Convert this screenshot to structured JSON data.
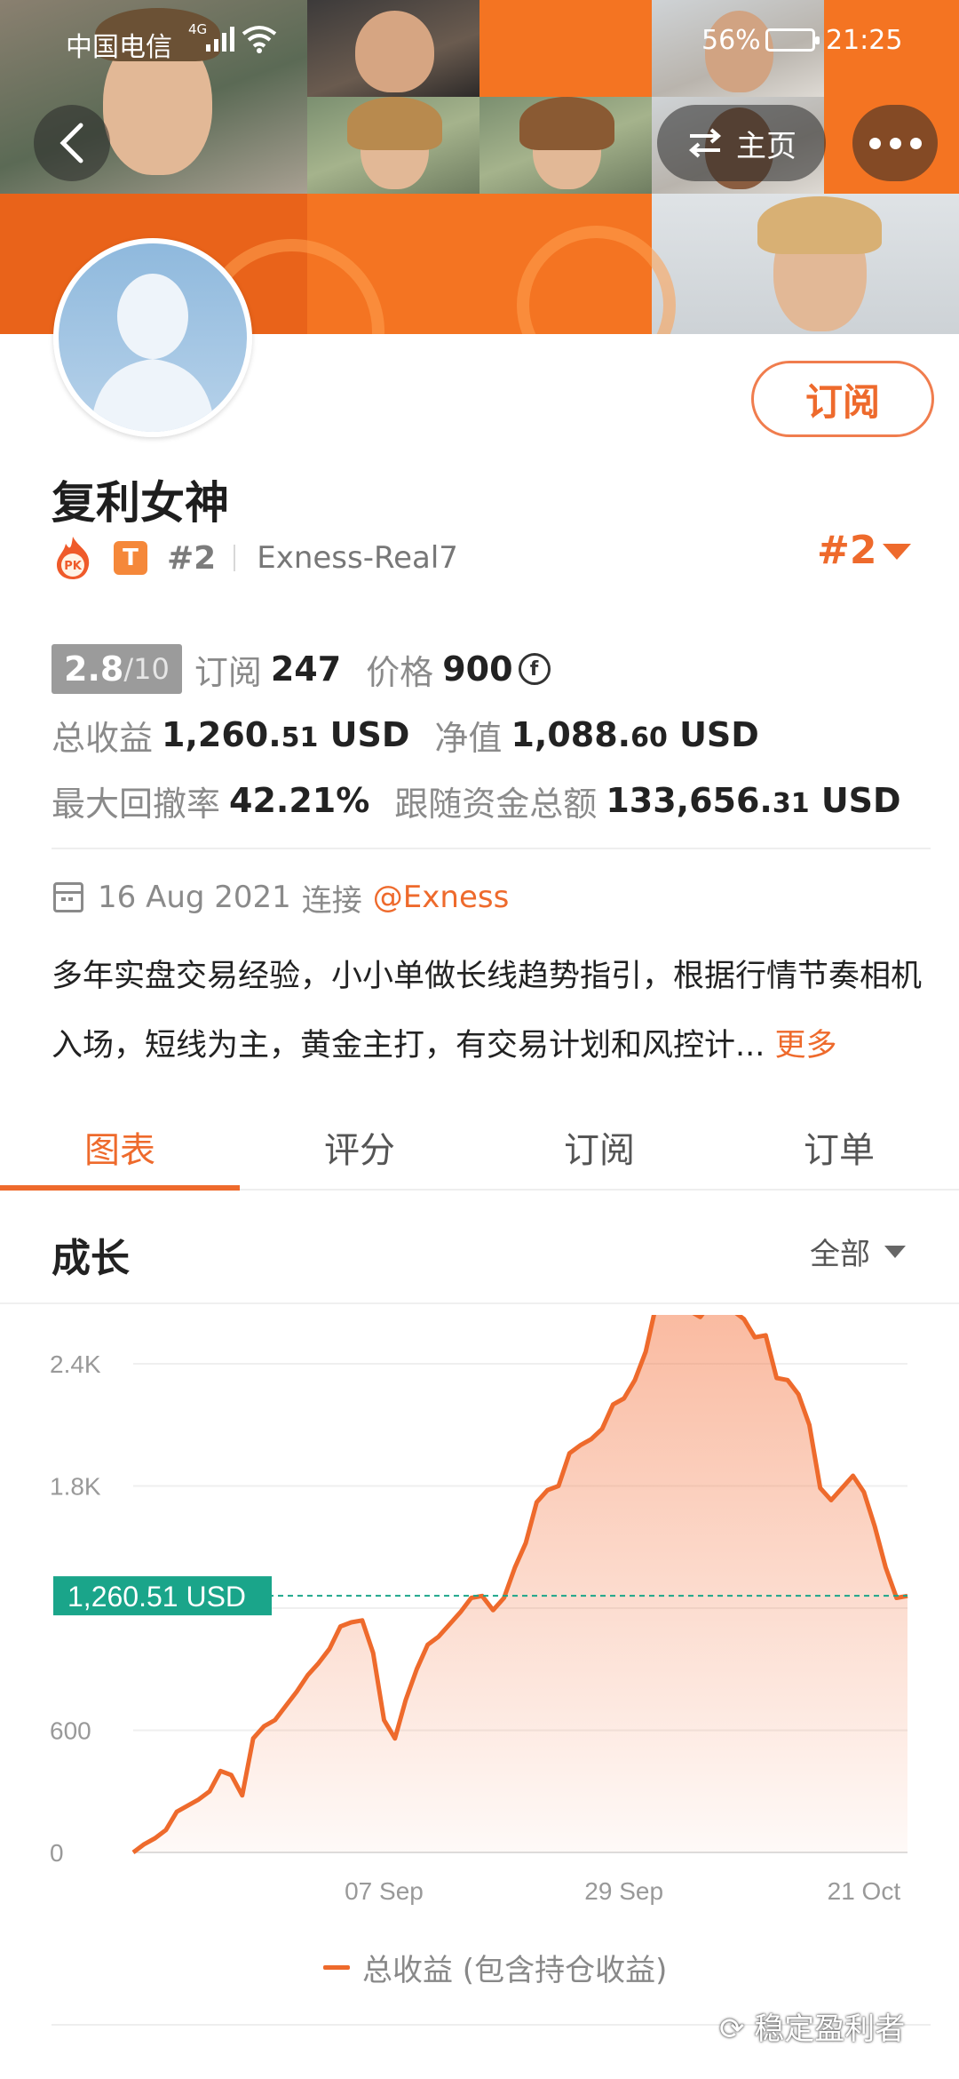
{
  "status_bar": {
    "carrier": "中国电信",
    "network": "4G",
    "battery": "56%",
    "time": "21:25"
  },
  "header": {
    "home_label": "主页"
  },
  "profile": {
    "name": "复利女神",
    "badge_t": "T",
    "rank_small": "#2",
    "server": "Exness-Real7",
    "rank_big": "#2",
    "subscribe_label": "订阅"
  },
  "stats": {
    "score": "2.8",
    "score_max": "/10",
    "subscribers_label": "订阅",
    "subscribers": "247",
    "price_label": "价格",
    "price": "900",
    "price_coin": "f",
    "total_profit_label": "总收益",
    "total_profit_int": "1,260.",
    "total_profit_dec": "51",
    "currency": "USD",
    "net_value_label": "净值",
    "net_value_int": "1,088.",
    "net_value_dec": "60",
    "max_drawdown_label": "最大回撤率",
    "max_drawdown": "42.21%",
    "follow_funds_label": "跟随资金总额",
    "follow_funds_int": "133,656.",
    "follow_funds_dec": "31"
  },
  "info": {
    "date": "16 Aug 2021",
    "connect_label": "连接",
    "broker": "@Exness",
    "description": "多年实盘交易经验，小小单做长线趋势指引，根据行情节奏相机入场，短线为主，黄金主打，有交易计划和风控计...",
    "more_label": "更多"
  },
  "tabs": [
    "图表",
    "评分",
    "订阅",
    "订单"
  ],
  "active_tab": 0,
  "section": {
    "title": "成长",
    "filter": "全部"
  },
  "chart_data": {
    "type": "area",
    "title": "成长",
    "series": [
      {
        "name": "总收益 (包含持仓收益)",
        "color": "#ee6a2c",
        "x": [
          0,
          1,
          2,
          3,
          4,
          5,
          6,
          7,
          8,
          9,
          10,
          11,
          12,
          13,
          14,
          15,
          16,
          17,
          18,
          19,
          20,
          21,
          22,
          23,
          24,
          25,
          26,
          27,
          28,
          29,
          30,
          31,
          32,
          33,
          34,
          35,
          36,
          37,
          38,
          39,
          40,
          41,
          42,
          43,
          44,
          45,
          46,
          47,
          48,
          49,
          50,
          51,
          52,
          53,
          54,
          55,
          56,
          57,
          58,
          59,
          60,
          61,
          62,
          63,
          64,
          65,
          66,
          67,
          68,
          69,
          70,
          71
        ],
        "values": [
          0,
          40,
          70,
          110,
          200,
          230,
          260,
          300,
          400,
          380,
          280,
          560,
          620,
          650,
          720,
          790,
          870,
          930,
          1000,
          1110,
          1130,
          1140,
          980,
          650,
          560,
          750,
          900,
          1020,
          1060,
          1120,
          1180,
          1250,
          1260,
          1190,
          1250,
          1400,
          1520,
          1720,
          1780,
          1800,
          1960,
          2000,
          2030,
          2080,
          2200,
          2230,
          2320,
          2460,
          2700,
          2850,
          2660,
          2660,
          2630,
          2700,
          2740,
          2660,
          2620,
          2530,
          2540,
          2330,
          2320,
          2250,
          2100,
          1790,
          1730,
          1790,
          1850,
          1770,
          1600,
          1400,
          1250,
          1260
        ],
        "x_ticks": [
          {
            "pos": 23,
            "label": "07 Sep"
          },
          {
            "pos": 45,
            "label": "29 Sep"
          },
          {
            "pos": 67,
            "label": "21 Oct"
          }
        ]
      }
    ],
    "y_ticks": [
      0,
      600,
      1200,
      1800,
      2400
    ],
    "y_tick_labels": [
      "0",
      "600",
      "",
      "1.8K",
      "2.4K"
    ],
    "ylim": [
      0,
      2400
    ],
    "current_value": 1260.51,
    "current_label": "1,260.51 USD",
    "reference_color": "#1aa58a",
    "grid": true
  },
  "legend_label": "总收益 (包含持仓收益)",
  "watermark": "稳定盈利者"
}
